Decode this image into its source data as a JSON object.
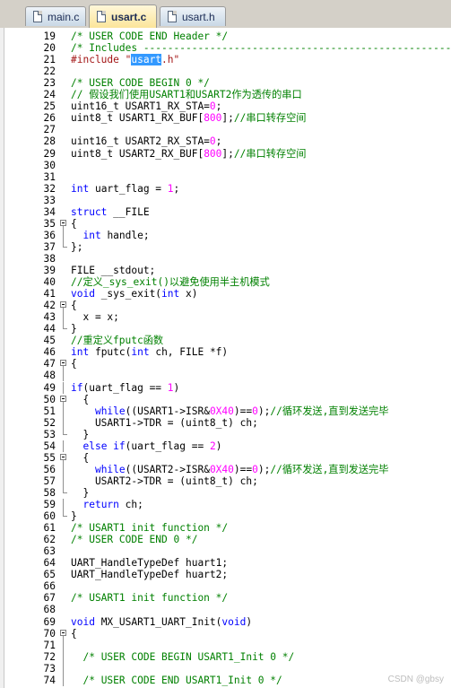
{
  "tabs": [
    {
      "label": "main.c",
      "active": false
    },
    {
      "label": "usart.c",
      "active": true
    },
    {
      "label": "usart.h",
      "active": false
    }
  ],
  "lines": [
    {
      "n": 19,
      "fold": "",
      "segs": [
        [
          "cm",
          "/* USER CODE END Header */"
        ]
      ]
    },
    {
      "n": 20,
      "fold": "",
      "segs": [
        [
          "cm",
          "/* Includes ------------------------------------------------------------------"
        ]
      ]
    },
    {
      "n": 21,
      "fold": "",
      "segs": [
        [
          "str",
          "#include \""
        ],
        [
          "sel",
          "usart"
        ],
        [
          "str",
          ".h\""
        ]
      ]
    },
    {
      "n": 22,
      "fold": "",
      "segs": []
    },
    {
      "n": 23,
      "fold": "",
      "segs": [
        [
          "cm",
          "/* USER CODE BEGIN 0 */"
        ]
      ]
    },
    {
      "n": 24,
      "fold": "",
      "segs": [
        [
          "cm",
          "// 假设我们使用USART1和USART2作为透传的串口"
        ]
      ]
    },
    {
      "n": 25,
      "fold": "",
      "segs": [
        [
          "",
          "uint16_t USART1_RX_STA="
        ],
        [
          "num",
          "0"
        ],
        [
          "",
          ";"
        ]
      ]
    },
    {
      "n": 26,
      "fold": "",
      "segs": [
        [
          "",
          "uint8_t USART1_RX_BUF["
        ],
        [
          "num",
          "800"
        ],
        [
          "",
          "];"
        ],
        [
          "cm",
          "//串口转存空间"
        ]
      ]
    },
    {
      "n": 27,
      "fold": "",
      "segs": []
    },
    {
      "n": 28,
      "fold": "",
      "segs": [
        [
          "",
          "uint16_t USART2_RX_STA="
        ],
        [
          "num",
          "0"
        ],
        [
          "",
          ";"
        ]
      ]
    },
    {
      "n": 29,
      "fold": "",
      "segs": [
        [
          "",
          "uint8_t USART2_RX_BUF["
        ],
        [
          "num",
          "800"
        ],
        [
          "",
          "];"
        ],
        [
          "cm",
          "//串口转存空间"
        ]
      ]
    },
    {
      "n": 30,
      "fold": "",
      "segs": []
    },
    {
      "n": 31,
      "fold": "",
      "segs": []
    },
    {
      "n": 32,
      "fold": "",
      "segs": [
        [
          "kw",
          "int"
        ],
        [
          "",
          " uart_flag = "
        ],
        [
          "num",
          "1"
        ],
        [
          "",
          ";"
        ]
      ]
    },
    {
      "n": 33,
      "fold": "",
      "segs": []
    },
    {
      "n": 34,
      "fold": "",
      "segs": [
        [
          "kw",
          "struct"
        ],
        [
          "",
          " __FILE"
        ]
      ]
    },
    {
      "n": 35,
      "fold": "start",
      "segs": [
        [
          "",
          "{"
        ]
      ]
    },
    {
      "n": 36,
      "fold": "mid",
      "segs": [
        [
          "",
          "  "
        ],
        [
          "kw",
          "int"
        ],
        [
          "",
          " handle;"
        ]
      ]
    },
    {
      "n": 37,
      "fold": "end",
      "segs": [
        [
          "",
          "};"
        ]
      ]
    },
    {
      "n": 38,
      "fold": "",
      "segs": []
    },
    {
      "n": 39,
      "fold": "",
      "segs": [
        [
          "",
          "FILE __stdout;"
        ]
      ]
    },
    {
      "n": 40,
      "fold": "",
      "segs": [
        [
          "cm",
          "//定义_sys_exit()以避免使用半主机模式"
        ]
      ]
    },
    {
      "n": 41,
      "fold": "",
      "segs": [
        [
          "kw",
          "void"
        ],
        [
          "",
          " _sys_exit("
        ],
        [
          "kw",
          "int"
        ],
        [
          "",
          " x)"
        ]
      ]
    },
    {
      "n": 42,
      "fold": "start",
      "segs": [
        [
          "",
          "{"
        ]
      ]
    },
    {
      "n": 43,
      "fold": "mid",
      "segs": [
        [
          "",
          "  x = x;"
        ]
      ]
    },
    {
      "n": 44,
      "fold": "end",
      "segs": [
        [
          "",
          "}"
        ]
      ]
    },
    {
      "n": 45,
      "fold": "",
      "segs": [
        [
          "cm",
          "//重定义fputc函数"
        ]
      ]
    },
    {
      "n": 46,
      "fold": "",
      "segs": [
        [
          "kw",
          "int"
        ],
        [
          "",
          " fputc("
        ],
        [
          "kw",
          "int"
        ],
        [
          "",
          " ch, FILE *f)"
        ]
      ]
    },
    {
      "n": 47,
      "fold": "start",
      "segs": [
        [
          "",
          "{"
        ]
      ]
    },
    {
      "n": 48,
      "fold": "mid",
      "segs": []
    },
    {
      "n": 49,
      "fold": "mid",
      "segs": [
        [
          "kw",
          "if"
        ],
        [
          "",
          "(uart_flag == "
        ],
        [
          "num",
          "1"
        ],
        [
          "",
          ")"
        ]
      ]
    },
    {
      "n": 50,
      "fold": "start",
      "segs": [
        [
          "",
          "  {"
        ]
      ]
    },
    {
      "n": 51,
      "fold": "mid",
      "segs": [
        [
          "",
          "    "
        ],
        [
          "kw",
          "while"
        ],
        [
          "",
          "((USART1->ISR&"
        ],
        [
          "num",
          "0X40"
        ],
        [
          "",
          ")=="
        ],
        [
          "num",
          "0"
        ],
        [
          "",
          ");"
        ],
        [
          "cm",
          "//循环发送,直到发送完毕"
        ]
      ]
    },
    {
      "n": 52,
      "fold": "mid",
      "segs": [
        [
          "",
          "    USART1->TDR = (uint8_t) ch;"
        ]
      ]
    },
    {
      "n": 53,
      "fold": "end",
      "segs": [
        [
          "",
          "  }"
        ]
      ]
    },
    {
      "n": 54,
      "fold": "mid",
      "segs": [
        [
          "",
          "  "
        ],
        [
          "kw",
          "else if"
        ],
        [
          "",
          "(uart_flag == "
        ],
        [
          "num",
          "2"
        ],
        [
          "",
          ")"
        ]
      ]
    },
    {
      "n": 55,
      "fold": "start",
      "segs": [
        [
          "",
          "  {"
        ]
      ]
    },
    {
      "n": 56,
      "fold": "mid",
      "segs": [
        [
          "",
          "    "
        ],
        [
          "kw",
          "while"
        ],
        [
          "",
          "((USART2->ISR&"
        ],
        [
          "num",
          "0X40"
        ],
        [
          "",
          ")=="
        ],
        [
          "num",
          "0"
        ],
        [
          "",
          ");"
        ],
        [
          "cm",
          "//循环发送,直到发送完毕"
        ]
      ]
    },
    {
      "n": 57,
      "fold": "mid",
      "segs": [
        [
          "",
          "    USART2->TDR = (uint8_t) ch;"
        ]
      ]
    },
    {
      "n": 58,
      "fold": "end",
      "segs": [
        [
          "",
          "  }"
        ]
      ]
    },
    {
      "n": 59,
      "fold": "mid",
      "segs": [
        [
          "",
          "  "
        ],
        [
          "kw",
          "return"
        ],
        [
          "",
          " ch;"
        ]
      ]
    },
    {
      "n": 60,
      "fold": "end",
      "segs": [
        [
          "",
          "}"
        ]
      ]
    },
    {
      "n": 61,
      "fold": "",
      "segs": [
        [
          "cm",
          "/* USART1 init function */"
        ]
      ]
    },
    {
      "n": 62,
      "fold": "",
      "segs": [
        [
          "cm",
          "/* USER CODE END 0 */"
        ]
      ]
    },
    {
      "n": 63,
      "fold": "",
      "segs": []
    },
    {
      "n": 64,
      "fold": "",
      "segs": [
        [
          "",
          "UART_HandleTypeDef huart1;"
        ]
      ]
    },
    {
      "n": 65,
      "fold": "",
      "segs": [
        [
          "",
          "UART_HandleTypeDef huart2;"
        ]
      ]
    },
    {
      "n": 66,
      "fold": "",
      "segs": []
    },
    {
      "n": 67,
      "fold": "",
      "segs": [
        [
          "cm",
          "/* USART1 init function */"
        ]
      ]
    },
    {
      "n": 68,
      "fold": "",
      "segs": []
    },
    {
      "n": 69,
      "fold": "",
      "segs": [
        [
          "kw",
          "void"
        ],
        [
          "",
          " MX_USART1_UART_Init("
        ],
        [
          "kw",
          "void"
        ],
        [
          "",
          ")"
        ]
      ]
    },
    {
      "n": 70,
      "fold": "start",
      "segs": [
        [
          "",
          "{"
        ]
      ]
    },
    {
      "n": 71,
      "fold": "mid",
      "segs": []
    },
    {
      "n": 72,
      "fold": "mid",
      "segs": [
        [
          "",
          "  "
        ],
        [
          "cm",
          "/* USER CODE BEGIN USART1_Init 0 */"
        ]
      ]
    },
    {
      "n": 73,
      "fold": "mid",
      "segs": []
    },
    {
      "n": 74,
      "fold": "mid",
      "segs": [
        [
          "",
          "  "
        ],
        [
          "cm",
          "/* USER CODE END USART1_Init 0 */"
        ]
      ]
    }
  ],
  "watermark": "CSDN @gbsy"
}
